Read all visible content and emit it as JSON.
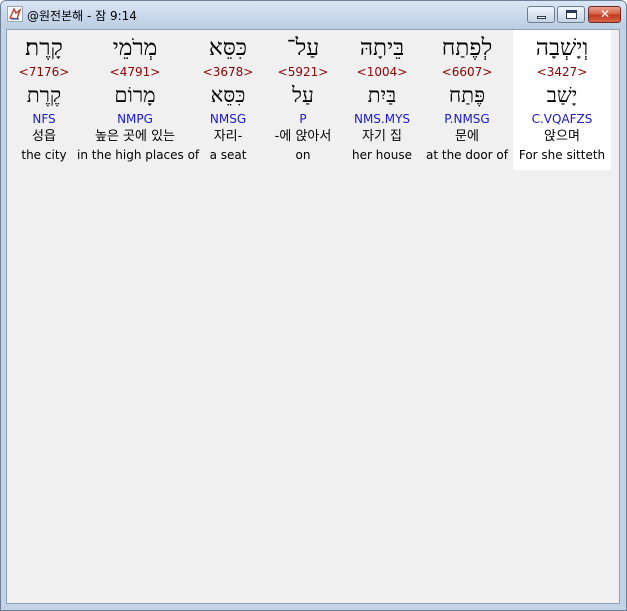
{
  "window": {
    "title": "@원전본해 - 잠 9:14",
    "icon": "app-logo-icon",
    "controls": {
      "minimize": "minimize-icon",
      "maximize": "maximize-icon",
      "close_glyph": "✕"
    }
  },
  "verse": {
    "words": [
      {
        "hebrew": "וְיָשְׁבָה",
        "strong": "<3427>",
        "lemma": "יָשַׁב",
        "parse": "C.VQAFZS",
        "korean": "앉으며",
        "english": "For she sitteth"
      },
      {
        "hebrew": "לְפֶתַח",
        "strong": "<6607>",
        "lemma": "פֶּתַח",
        "parse": "P.NMSG",
        "korean": "문에",
        "english": "at the door of"
      },
      {
        "hebrew": "בֵּיתָהּ",
        "strong": "<1004>",
        "lemma": "בַּיִת",
        "parse": "NMS.MYS",
        "korean": "자기 집",
        "english": "her house"
      },
      {
        "hebrew": "עַל־",
        "strong": "<5921>",
        "lemma": "עַל",
        "parse": "P",
        "korean": "-에 앉아서",
        "english": "on"
      },
      {
        "hebrew": "כִּסֵּא",
        "strong": "<3678>",
        "lemma": "כִּסֵּא",
        "parse": "NMSG",
        "korean": "자리-",
        "english": "a seat"
      },
      {
        "hebrew": "מְרֹמֵי",
        "strong": "<4791>",
        "lemma": "מָרוֹם",
        "parse": "NMPG",
        "korean": "높은 곳에 있는",
        "english": "in the high places of"
      },
      {
        "hebrew": "קָרֶת׃",
        "strong": "<7176>",
        "lemma": "קֶרֶת",
        "parse": "NFS",
        "korean": "성읍",
        "english": "the city"
      }
    ]
  },
  "colors": {
    "strong_number": "#8b0000",
    "parsing": "#1a1ac8",
    "selected_word_bg": "#ffffff",
    "client_bg": "#f0f0f0"
  }
}
